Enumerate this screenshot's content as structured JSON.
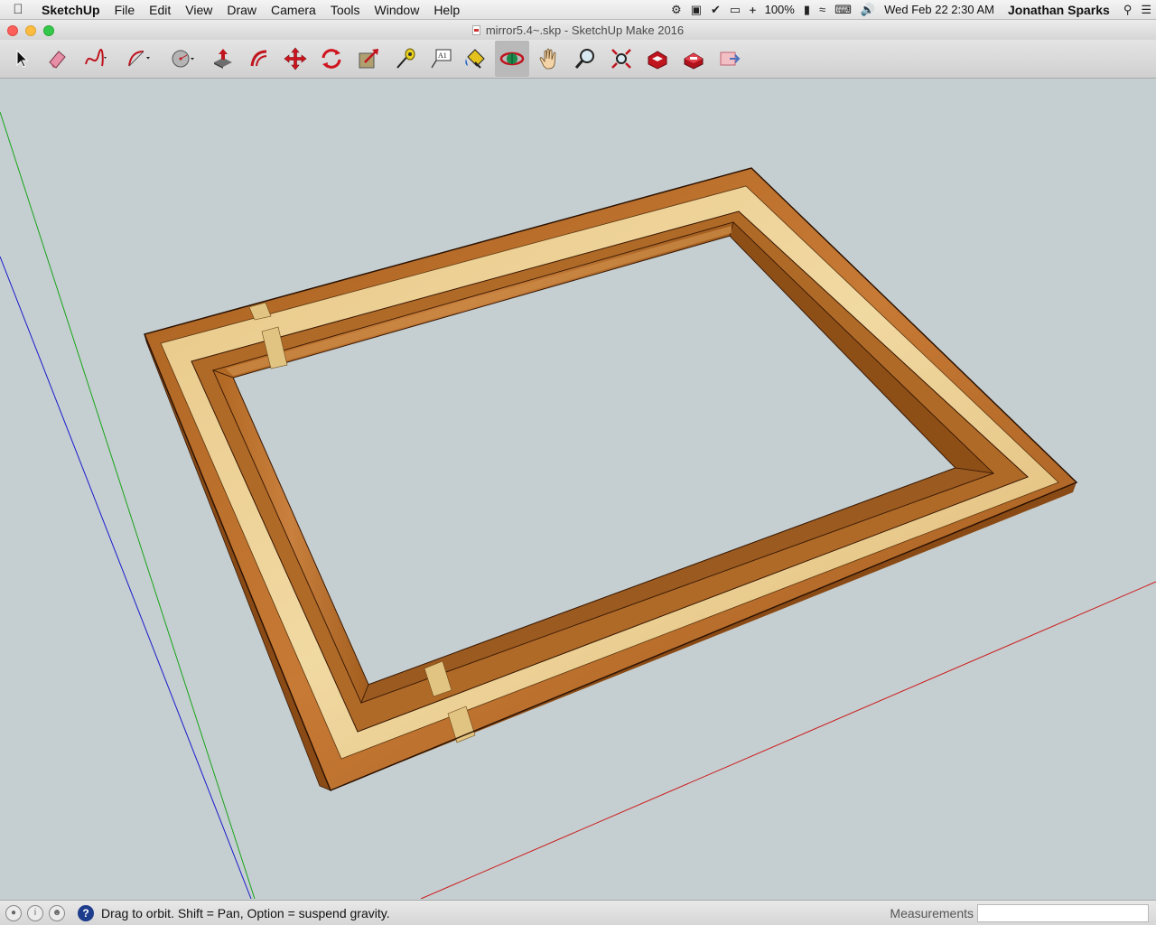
{
  "menubar": {
    "app_name": "SketchUp",
    "menus": [
      "File",
      "Edit",
      "View",
      "Draw",
      "Camera",
      "Tools",
      "Window",
      "Help"
    ],
    "battery": "100%",
    "datetime": "Wed Feb 22  2:30 AM",
    "user": "Jonathan Sparks"
  },
  "window": {
    "title": "mirror5.4~.skp - SketchUp Make 2016"
  },
  "toolbar": {
    "tools": [
      {
        "name": "select-tool",
        "icon": "arrow-icon"
      },
      {
        "name": "eraser-tool",
        "icon": "eraser-icon"
      },
      {
        "name": "freehand-tool",
        "icon": "freehand-icon"
      },
      {
        "name": "arc-tool",
        "icon": "arc-icon"
      },
      {
        "name": "circle-tool",
        "icon": "circle-icon"
      },
      {
        "name": "push-pull-tool",
        "icon": "push-pull-icon"
      },
      {
        "name": "offset-tool",
        "icon": "offset-icon"
      },
      {
        "name": "move-tool",
        "icon": "move-icon"
      },
      {
        "name": "rotate-tool",
        "icon": "rotate-icon"
      },
      {
        "name": "scale-tool",
        "icon": "scale-icon"
      },
      {
        "name": "tape-measure-tool",
        "icon": "tape-measure-icon"
      },
      {
        "name": "text-tool",
        "icon": "text-icon",
        "label": "A1"
      },
      {
        "name": "paint-bucket-tool",
        "icon": "paint-bucket-icon"
      },
      {
        "name": "orbit-tool",
        "icon": "orbit-icon",
        "active": true
      },
      {
        "name": "pan-tool",
        "icon": "pan-hand-icon"
      },
      {
        "name": "zoom-tool",
        "icon": "zoom-icon"
      },
      {
        "name": "zoom-extents-tool",
        "icon": "zoom-extents-icon"
      },
      {
        "name": "warehouse-tool",
        "icon": "3d-warehouse-icon"
      },
      {
        "name": "extension-warehouse-tool",
        "icon": "extension-warehouse-icon"
      },
      {
        "name": "share-model-tool",
        "icon": "share-model-icon"
      }
    ]
  },
  "statusbar": {
    "message": "Drag to orbit. Shift = Pan, Option = suspend gravity.",
    "measurements_label": "Measurements",
    "measurements_value": ""
  },
  "colors": {
    "viewport_bg": "#c5cfd1",
    "axis_green": "#1aa31a",
    "axis_blue": "#1a1acc",
    "axis_red": "#cc1a1a",
    "wood_dark": "#9a5a20",
    "wood_mid": "#b8702e",
    "wood_light": "#e6c27e"
  }
}
